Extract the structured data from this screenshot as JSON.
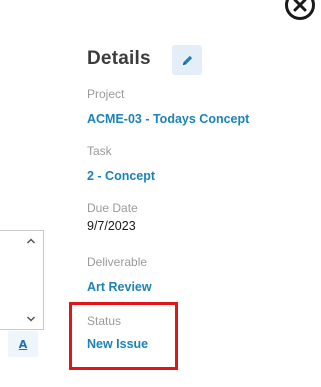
{
  "details": {
    "title": "Details",
    "fields": [
      {
        "label": "Project",
        "value": "ACME-03 - Todays Concept"
      },
      {
        "label": "Task",
        "value": "2 - Concept"
      },
      {
        "label": "Due Date",
        "value": "9/7/2023"
      },
      {
        "label": "Deliverable",
        "value": "Art Review"
      },
      {
        "label": "Status",
        "value": "New Issue"
      }
    ]
  },
  "toolbar": {
    "format_glyph": "A"
  },
  "colors": {
    "link": "#1d82b9",
    "label": "#9a9a9a",
    "highlight": "#e0161b",
    "edit_button_bg": "#e3eef8"
  }
}
